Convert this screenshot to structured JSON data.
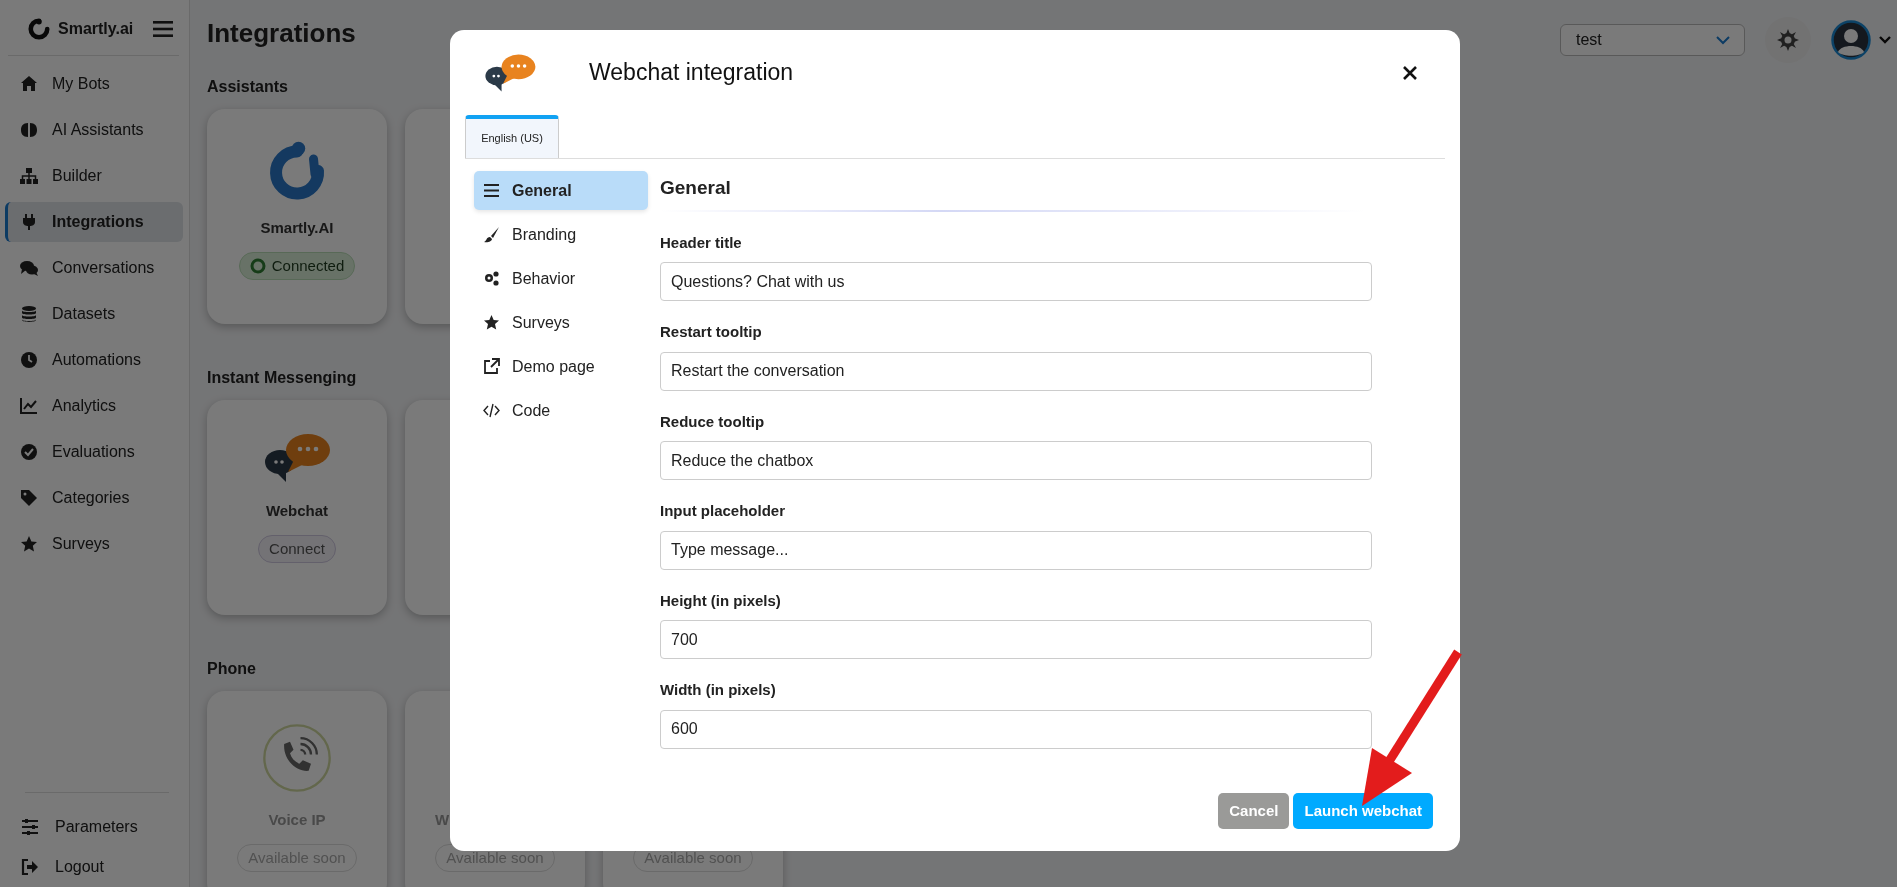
{
  "sidebar": {
    "brand": "Smartly.ai",
    "items": [
      {
        "label": "My Bots",
        "selected": false
      },
      {
        "label": "AI Assistants",
        "selected": false
      },
      {
        "label": "Builder",
        "selected": false
      },
      {
        "label": "Integrations",
        "selected": true
      },
      {
        "label": "Conversations",
        "selected": false
      },
      {
        "label": "Datasets",
        "selected": false
      },
      {
        "label": "Automations",
        "selected": false
      },
      {
        "label": "Analytics",
        "selected": false
      },
      {
        "label": "Evaluations",
        "selected": false
      },
      {
        "label": "Categories",
        "selected": false
      },
      {
        "label": "Surveys",
        "selected": false
      }
    ],
    "footer_items": [
      {
        "label": "Parameters"
      },
      {
        "label": "Logout"
      }
    ]
  },
  "page": {
    "title": "Integrations"
  },
  "topbar": {
    "bot_select": "test"
  },
  "sections": [
    {
      "title": "Assistants",
      "cards": [
        {
          "kind": "connected",
          "name": "Smartly.AI",
          "status": "Connected"
        },
        {
          "kind": "covered"
        }
      ]
    },
    {
      "title": "Instant Messenging",
      "cards": [
        {
          "kind": "connect",
          "name": "Webchat",
          "status": "Connect"
        },
        {
          "kind": "covered"
        }
      ]
    },
    {
      "title": "Phone",
      "cards": [
        {
          "kind": "soon",
          "name": "Voice IP",
          "status": "Available soon"
        },
        {
          "kind": "soon",
          "name": "W",
          "clipped": true,
          "status": "Available soon"
        },
        {
          "kind": "soon",
          "status": "Available soon"
        }
      ]
    }
  ],
  "modal": {
    "title": "Webchat integration",
    "tabs": [
      {
        "label": "English (US)",
        "selected": true
      }
    ],
    "nav": [
      {
        "label": "General",
        "selected": true
      },
      {
        "label": "Branding",
        "selected": false
      },
      {
        "label": "Behavior",
        "selected": false
      },
      {
        "label": "Surveys",
        "selected": false
      },
      {
        "label": "Demo page",
        "selected": false
      },
      {
        "label": "Code",
        "selected": false
      }
    ],
    "section_title": "General",
    "fields": [
      {
        "label": "Header title",
        "value": "Questions? Chat with us"
      },
      {
        "label": "Restart tooltip",
        "value": "Restart the conversation"
      },
      {
        "label": "Reduce tooltip",
        "value": "Reduce the chatbox"
      },
      {
        "label": "Input placeholder",
        "value": "Type message..."
      },
      {
        "label": "Height (in pixels)",
        "value": "700"
      },
      {
        "label": "Width (in pixels)",
        "value": "600"
      }
    ],
    "buttons": [
      {
        "kind": "secondary",
        "label": "Cancel"
      },
      {
        "kind": "primary",
        "label": "Launch webchat"
      }
    ]
  }
}
